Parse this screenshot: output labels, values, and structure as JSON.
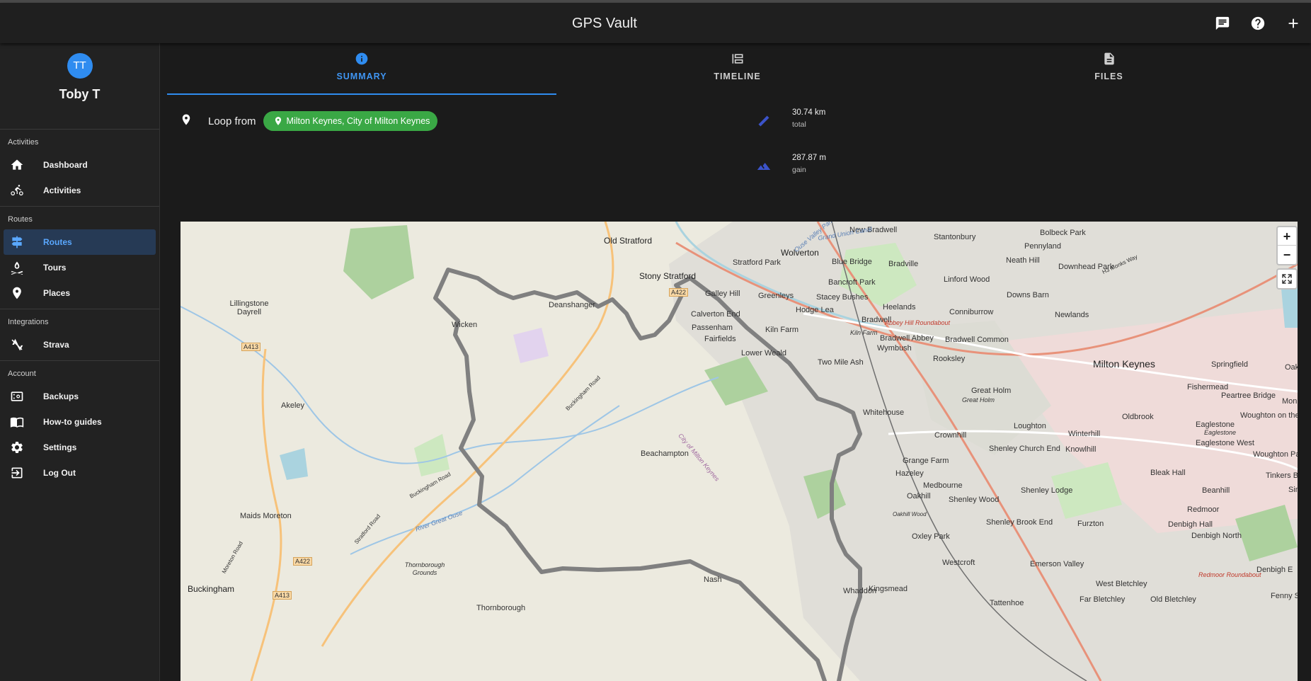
{
  "app": {
    "title": "GPS Vault"
  },
  "header": {
    "actions": [
      {
        "icon": "feedback-icon"
      },
      {
        "icon": "help-icon"
      },
      {
        "icon": "add-icon"
      }
    ]
  },
  "sidebar": {
    "profile": {
      "initials": "TT",
      "name": "Toby T",
      "avatar_color": "#2f8cf0"
    },
    "sections": [
      {
        "title": "Activities",
        "items": [
          {
            "label": "Dashboard",
            "icon": "home-icon"
          },
          {
            "label": "Activities",
            "icon": "bike-icon"
          }
        ]
      },
      {
        "title": "Routes",
        "items": [
          {
            "label": "Routes",
            "icon": "signpost-icon",
            "active": true
          },
          {
            "label": "Tours",
            "icon": "campfire-icon"
          },
          {
            "label": "Places",
            "icon": "pin-icon"
          }
        ]
      },
      {
        "title": "Integrations",
        "items": [
          {
            "label": "Strava",
            "icon": "strava-off-icon"
          }
        ]
      },
      {
        "title": "Account",
        "items": [
          {
            "label": "Backups",
            "icon": "backup-icon"
          },
          {
            "label": "How-to guides",
            "icon": "book-icon"
          },
          {
            "label": "Settings",
            "icon": "gear-icon"
          },
          {
            "label": "Log Out",
            "icon": "logout-icon"
          }
        ]
      }
    ]
  },
  "tabs": [
    {
      "label": "SUMMARY",
      "icon": "info-icon",
      "active": true
    },
    {
      "label": "TIMELINE",
      "icon": "timeline-icon"
    },
    {
      "label": "FILES",
      "icon": "file-icon"
    }
  ],
  "summary": {
    "loop_label": "Loop from",
    "location": "Milton Keynes, City of Milton Keynes",
    "location_color": "#3aa845",
    "stats": [
      {
        "value": "30.74 km",
        "unit": "total",
        "icon": "ruler-icon"
      },
      {
        "value": "287.87 m",
        "unit": "gain",
        "icon": "mountain-icon"
      }
    ]
  },
  "map": {
    "zoom_in": "+",
    "zoom_out": "−",
    "places": [
      "Old Stratford",
      "Stony Stratford",
      "Wolverton",
      "New Bradwell",
      "Stantonbury",
      "Bolbeck Park",
      "Pennyland",
      "Neath Hill",
      "Downhead Park",
      "Stratford Park",
      "Blue Bridge",
      "Bradville",
      "Bancroft Park",
      "Linford Wood",
      "Downs Barn",
      "Galley Hill",
      "Greenleys",
      "Stacey Bushes",
      "Heelands",
      "Conniburrow",
      "Newlands",
      "Calverton End",
      "Hodge Lea",
      "Bradwell",
      "Fairfields",
      "Kiln Farm",
      "Bradwell Abbey",
      "Bradwell Common",
      "Wymbush",
      "Lower Weald",
      "Rooksley",
      "Two Mile Ash",
      "Milton Keynes",
      "Springfield",
      "Oakg",
      "Fishermead",
      "Great Holm",
      "Whitehouse",
      "Peartree Bridge",
      "Mon",
      "Oldbrook",
      "Loughton",
      "Eaglestone",
      "Woughton on the Green",
      "Crownhill",
      "Shenley Church End",
      "Winterhill",
      "Eaglestone West",
      "Beachampton",
      "Knowlhill",
      "Woughton Park",
      "Grange Farm",
      "Tinkers Bridge",
      "Bleak Hall",
      "Simp",
      "Hazeley",
      "Medbourne",
      "Shenley Lodge",
      "Beanhill",
      "Oakhill",
      "Shenley Wood",
      "Redmoor",
      "Shenley Brook End",
      "Furzton",
      "Denbigh Hall",
      "Denbigh North",
      "Oxley Park",
      "Westcroft",
      "Emerson Valley",
      "Denbigh E",
      "Kingsmead",
      "West Bletchley",
      "Nash",
      "Whaddon",
      "Tattenhoe",
      "Far Bletchley",
      "Old Bletchley",
      "Fenny S",
      "Lillingstone Dayrell",
      "Akeley",
      "Maids Moreton",
      "Buckingham",
      "Thornborough",
      "Thornborough Grounds",
      "Wicken",
      "Deanshanger",
      "Passenham"
    ],
    "road_labels": [
      "A422",
      "A413",
      "A422",
      "A413",
      "Buckingham Road",
      "Stratford Road",
      "Moreton Road",
      "Buckingham Road",
      "H3 Monks Way"
    ],
    "minor_labels": [
      "Abbey Hill Roundabout",
      "Redmoor Roundabout",
      "Great Holm",
      "Kiln Farm",
      "Eaglestone",
      "Oakhill Wood",
      "River Great Ouse",
      "City of Milton Keynes",
      "Ouse Valley Park",
      "Grand Union Canal"
    ]
  }
}
